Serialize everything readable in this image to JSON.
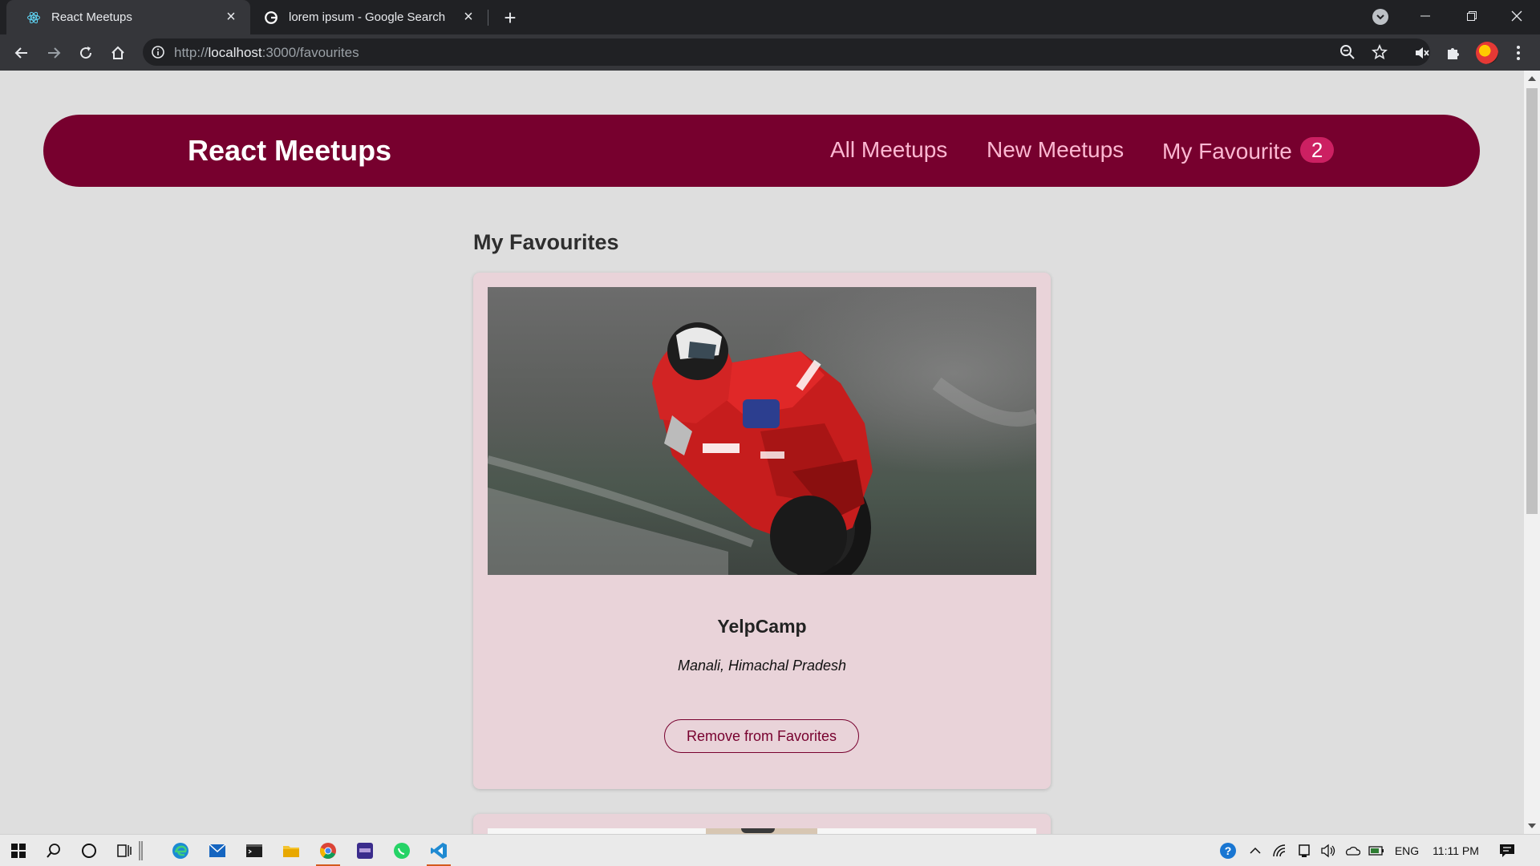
{
  "browser": {
    "tabs": [
      {
        "title": "React Meetups",
        "active": true,
        "icon": "react-icon"
      },
      {
        "title": "lorem ipsum - Google Search",
        "active": false,
        "icon": "google-icon"
      }
    ],
    "address": {
      "scheme": "http://",
      "host": "localhost",
      "rest": ":3000/favourites"
    }
  },
  "app": {
    "brand": "React Meetups",
    "nav": {
      "all": "All Meetups",
      "new": "New Meetups",
      "favourites": "My Favourite",
      "favourites_count": "2"
    },
    "page_title": "My Favourites",
    "meetups": [
      {
        "title": "YelpCamp",
        "address": "Manali, Himachal Pradesh",
        "button": "Remove from Favorites",
        "image": "motorcycle-racer-photo"
      }
    ]
  },
  "taskbar": {
    "language": "ENG",
    "time": "11:11 PM"
  },
  "colors": {
    "navbar": "#77002e",
    "nav_link": "#fcb8d2",
    "badge": "#cc2062",
    "card": "#e9d3d9",
    "page_bg": "#dedede"
  }
}
